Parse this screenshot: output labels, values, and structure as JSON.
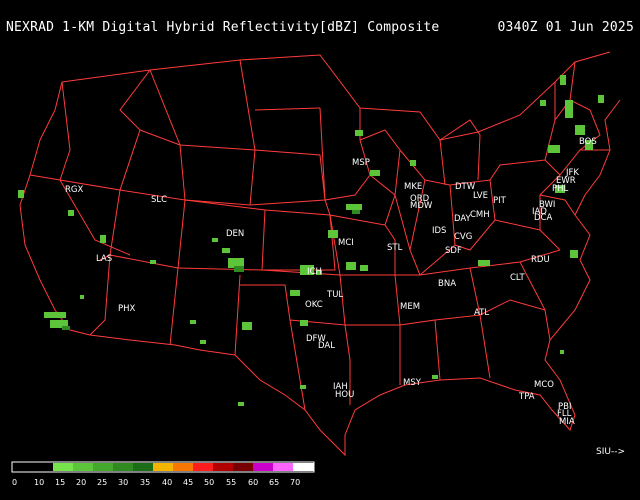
{
  "header": {
    "title": "NEXRAD 1-KM Digital Hybrid Reflectivity[dBZ] Composite",
    "timestamp": "0340Z 01 Jun 2025"
  },
  "cities": [
    "RGX",
    "SLC",
    "DEN",
    "LAS",
    "PHX",
    "MSP",
    "MKE",
    "ORD",
    "MDW",
    "DTW",
    "LVE",
    "PIT",
    "IDS",
    "DAY",
    "CMH",
    "CVG",
    "SDF",
    "STL",
    "MCI",
    "ICH",
    "TUL",
    "OKC",
    "DFW",
    "DAL",
    "IAH",
    "HOU",
    "MSY",
    "MEM",
    "BNA",
    "ATL",
    "CLT",
    "RDU",
    "BOS",
    "JFK",
    "EWR",
    "PHL",
    "BWI",
    "IAD",
    "DCA",
    "MCO",
    "TPA",
    "PBI",
    "FLL",
    "MIA"
  ],
  "colorbar": {
    "ticks": [
      "0",
      "10",
      "15",
      "20",
      "25",
      "30",
      "35",
      "40",
      "45",
      "50",
      "55",
      "60",
      "65",
      "70"
    ],
    "colors": [
      "#000000",
      "#000000",
      "#76e34c",
      "#5dc53a",
      "#44a82c",
      "#2f8a21",
      "#1d6c17",
      "#f2b600",
      "#f77700",
      "#ff1c1c",
      "#b20000",
      "#780000",
      "#cc00cc",
      "#ff66ff",
      "#ffffff"
    ]
  },
  "sweep_label": "SIU-->"
}
